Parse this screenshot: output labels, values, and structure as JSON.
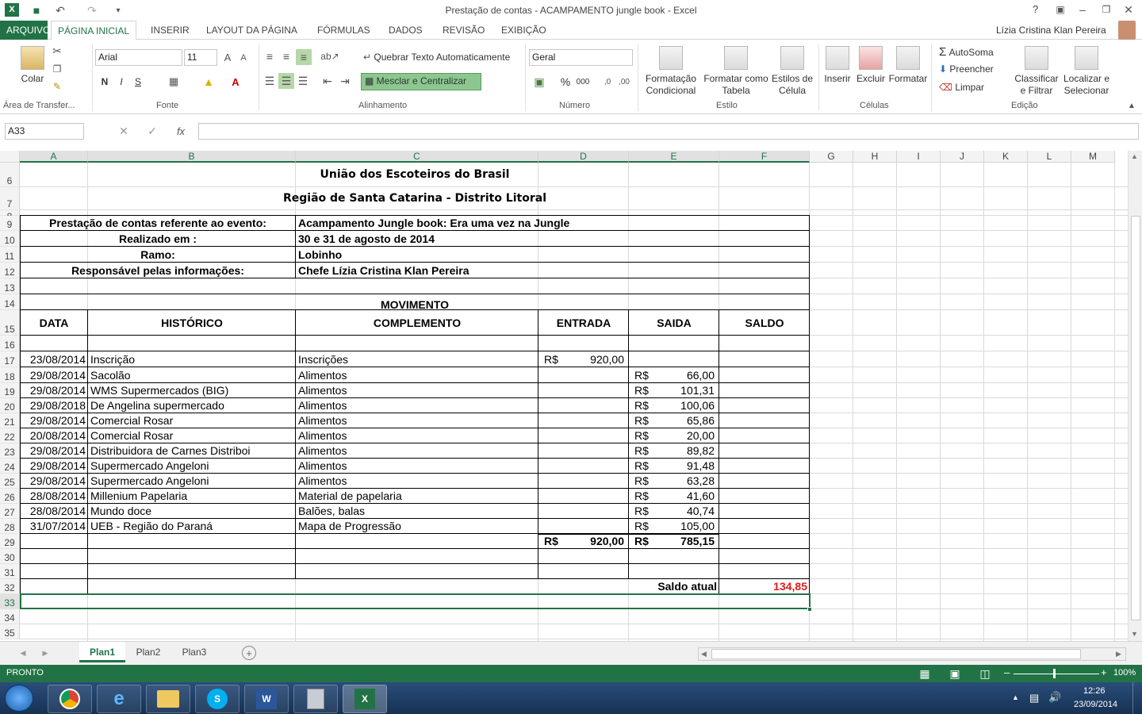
{
  "window": {
    "title": "Prestação de contas - ACAMPAMENTO jungle book - Excel",
    "help": "?",
    "user": "Lízia Cristina Klan Pereira"
  },
  "tabs": [
    "ARQUIVO",
    "PÁGINA INICIAL",
    "INSERIR",
    "LAYOUT DA PÁGINA",
    "FÓRMULAS",
    "DADOS",
    "REVISÃO",
    "EXIBIÇÃO"
  ],
  "ribbon": {
    "paste_label": "Colar",
    "font_name": "Arial",
    "font_size": "11",
    "bold": "N",
    "italic": "I",
    "underline": "S",
    "wrap_text": "Quebrar Texto Automaticamente",
    "merge_center": "Mesclar e Centralizar",
    "number_format": "Geral",
    "percent": "%",
    "thousands": "000",
    "conditional_format": [
      "Formatação",
      "Condicional"
    ],
    "format_table": [
      "Formatar como",
      "Tabela"
    ],
    "cell_styles": [
      "Estilos de",
      "Célula"
    ],
    "insert": "Inserir",
    "delete": "Excluir",
    "format": "Formatar",
    "autosum": "AutoSoma",
    "fill": "Preencher",
    "clear": "Limpar",
    "sort_filter": [
      "Classificar",
      "e Filtrar"
    ],
    "find_select": [
      "Localizar e",
      "Selecionar"
    ],
    "groups": [
      "Área de Transfer...",
      "Fonte",
      "Alinhamento",
      "Número",
      "Estilo",
      "Células",
      "Edição"
    ]
  },
  "formula_bar": {
    "name_box": "A33",
    "fx": "fx",
    "content": ""
  },
  "columns": [
    "A",
    "B",
    "C",
    "D",
    "E",
    "F",
    "G",
    "H",
    "I",
    "J",
    "K",
    "L",
    "M"
  ],
  "rows": [
    "6",
    "7",
    "8",
    "9",
    "10",
    "11",
    "12",
    "13",
    "14",
    "15",
    "16",
    "17",
    "18",
    "19",
    "20",
    "21",
    "22",
    "23",
    "24",
    "25",
    "26",
    "27",
    "28",
    "29",
    "30",
    "31",
    "32",
    "33",
    "34",
    "35"
  ],
  "sheet": {
    "header1": "União dos Escoteiros do Brasil",
    "header2": "Região de Santa Catarina  -  Distrito Litoral",
    "info": [
      {
        "label": "Prestação de contas referente ao evento:",
        "value": "Acampamento Jungle book: Era uma vez na Jungle"
      },
      {
        "label": "Realizado em :",
        "value": "30 e 31 de agosto de 2014"
      },
      {
        "label": "Ramo:",
        "value": "Lobinho"
      },
      {
        "label": "Responsável pelas informações:",
        "value": "Chefe Lízia Cristina Klan Pereira"
      }
    ],
    "movimento_title": "MOVIMENTO",
    "table_headers": [
      "DATA",
      "HISTÓRICO",
      "COMPLEMENTO",
      "ENTRADA",
      "SAIDA",
      "SALDO"
    ],
    "currency": "R$",
    "entries": [
      {
        "date": "23/08/2014",
        "hist": "Inscrição",
        "comp": "Inscrições",
        "in": "920,00",
        "out": ""
      },
      {
        "date": "29/08/2014",
        "hist": "Sacolão",
        "comp": "Alimentos",
        "in": "",
        "out": "66,00"
      },
      {
        "date": "29/08/2014",
        "hist": "WMS Supermercados (BIG)",
        "comp": "Alimentos",
        "in": "",
        "out": "101,31"
      },
      {
        "date": "29/08/2018",
        "hist": "De  Angelina supermercado",
        "comp": "Alimentos",
        "in": "",
        "out": "100,06"
      },
      {
        "date": "29/08/2014",
        "hist": "Comercial Rosar",
        "comp": "Alimentos",
        "in": "",
        "out": "65,86"
      },
      {
        "date": "20/08/2014",
        "hist": "Comercial Rosar",
        "comp": "Alimentos",
        "in": "",
        "out": "20,00"
      },
      {
        "date": "29/08/2014",
        "hist": "Distribuidora de Carnes Distriboi",
        "comp": "Alimentos",
        "in": "",
        "out": "89,82"
      },
      {
        "date": "29/08/2014",
        "hist": "Supermercado Angeloni",
        "comp": "Alimentos",
        "in": "",
        "out": "91,48"
      },
      {
        "date": "29/08/2014",
        "hist": "Supermercado Angeloni",
        "comp": "Alimentos",
        "in": "",
        "out": "63,28"
      },
      {
        "date": "28/08/2014",
        "hist": "Millenium Papelaria",
        "comp": "Material de papelaria",
        "in": "",
        "out": "41,60"
      },
      {
        "date": "28/08/2014",
        "hist": "Mundo doce",
        "comp": "Balões, balas",
        "in": "",
        "out": "40,74"
      },
      {
        "date": "31/07/2014",
        "hist": "UEB - Região do Paraná",
        "comp": "Mapa de Progressão",
        "in": "",
        "out": "105,00"
      }
    ],
    "total_in": "920,00",
    "total_out": "785,15",
    "saldo_label": "Saldo atual",
    "saldo_value": "134,85",
    "saldo_color": "#e01b1b"
  },
  "sheet_tabs": [
    "Plan1",
    "Plan2",
    "Plan3"
  ],
  "status": {
    "left": "PRONTO",
    "zoom": "100%"
  },
  "taskbar": {
    "time": "12:26",
    "date": "23/09/2014"
  },
  "colors": {
    "accent": "#217346"
  }
}
